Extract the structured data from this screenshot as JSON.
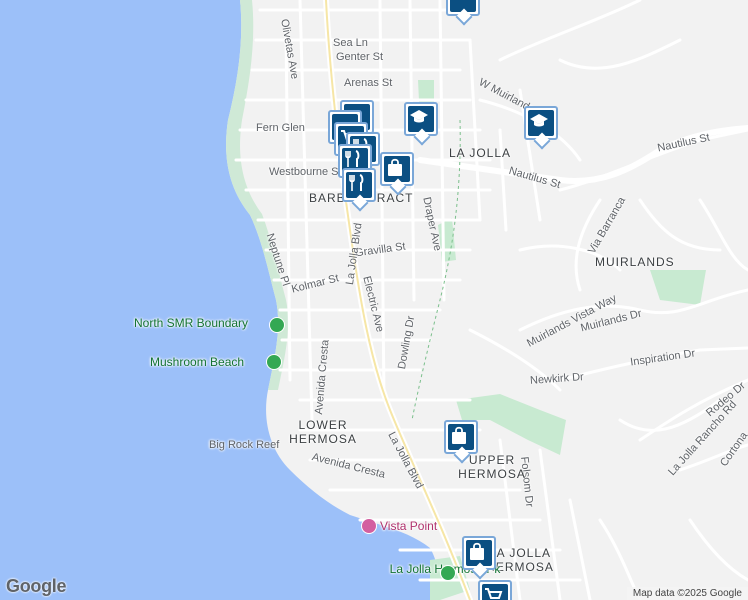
{
  "map": {
    "colors": {
      "water": "#9cc0f9",
      "land": "#f2f2f2",
      "park": "#c8ead1",
      "road": "#ffffff",
      "coast": "#cfe9d6"
    },
    "attribution": "Map data ©2025 Google",
    "logo": "Google",
    "neighborhoods": [
      {
        "id": "la-jolla",
        "text": "LA JOLLA"
      },
      {
        "id": "barber-tract",
        "text": "BARBER TRACT"
      },
      {
        "id": "muirlands",
        "text": "MUIRLANDS"
      },
      {
        "id": "lower-hermosa",
        "text": "LOWER HERMOSA"
      },
      {
        "id": "upper-hermosa",
        "text": "UPPER HERMOSA"
      },
      {
        "id": "la-jolla-hermosa",
        "text": "LA JOLLA HERMOSA"
      }
    ],
    "streets": {
      "sea_ln": "Sea Ln",
      "genter_st": "Genter St",
      "arenas_st": "Arenas St",
      "olivetas_ave": "Olivetas Ave",
      "fern_glen": "Fern Glen",
      "westbourne_st": "Westbourne St",
      "neptune_pl": "Neptune Pl",
      "kolmar_st": "Kolmar St",
      "gravilla_st": "Gravilla St",
      "la_jolla_blvd_1": "La Jolla Blvd",
      "la_jolla_blvd_2": "La Jolla Blvd",
      "electric_ave": "Electric Ave",
      "draper_ave": "Draper Ave",
      "dowling_dr": "Dowling Dr",
      "avenida_cresta_1": "Avenida Cresta",
      "avenida_cresta_2": "Avenida Cresta",
      "w_muirlands": "W Muirlands",
      "nautilus_st_1": "Nautilus St",
      "nautilus_st_2": "Nautilus St",
      "via_barranca": "Via Barranca",
      "muirlands_vista_way": "Muirlands Vista Way",
      "muirlands_dr": "Muirlands Dr",
      "inspiration_dr": "Inspiration Dr",
      "newkirk_dr": "Newkirk Dr",
      "rodeo_dr": "Rodeo Dr",
      "la_jolla_rancho_rd": "La Jolla Rancho Rd",
      "cortona": "Cortona",
      "folsom_dr": "Folsom Dr",
      "big_rock_reef": "Big Rock Reef"
    },
    "pois": [
      {
        "id": "north-smr",
        "text": "North SMR Boundary",
        "icon": "park-pin-icon"
      },
      {
        "id": "mushroom-beach",
        "text": "Mushroom Beach",
        "icon": "park-pin-icon"
      },
      {
        "id": "vista-point",
        "text": "Vista Point",
        "icon": "camera-pin-icon"
      },
      {
        "id": "hermosa-pk",
        "text": "La Jolla Hermosa Pk",
        "icon": "park-pin-icon"
      }
    ],
    "markers": [
      {
        "id": "school-1",
        "icon": "school-icon"
      },
      {
        "id": "school-2",
        "icon": "school-icon"
      },
      {
        "id": "school-3",
        "icon": "school-icon"
      },
      {
        "id": "grocery-cluster",
        "icon": "shopping-cart-icon"
      },
      {
        "id": "restaurant-1",
        "icon": "restaurant-icon"
      },
      {
        "id": "restaurant-2",
        "icon": "restaurant-icon"
      },
      {
        "id": "shop-1",
        "icon": "shopping-bag-icon"
      },
      {
        "id": "shop-2",
        "icon": "shopping-bag-icon"
      },
      {
        "id": "shop-3",
        "icon": "shopping-bag-icon"
      },
      {
        "id": "grocery-2",
        "icon": "shopping-cart-icon"
      }
    ]
  }
}
